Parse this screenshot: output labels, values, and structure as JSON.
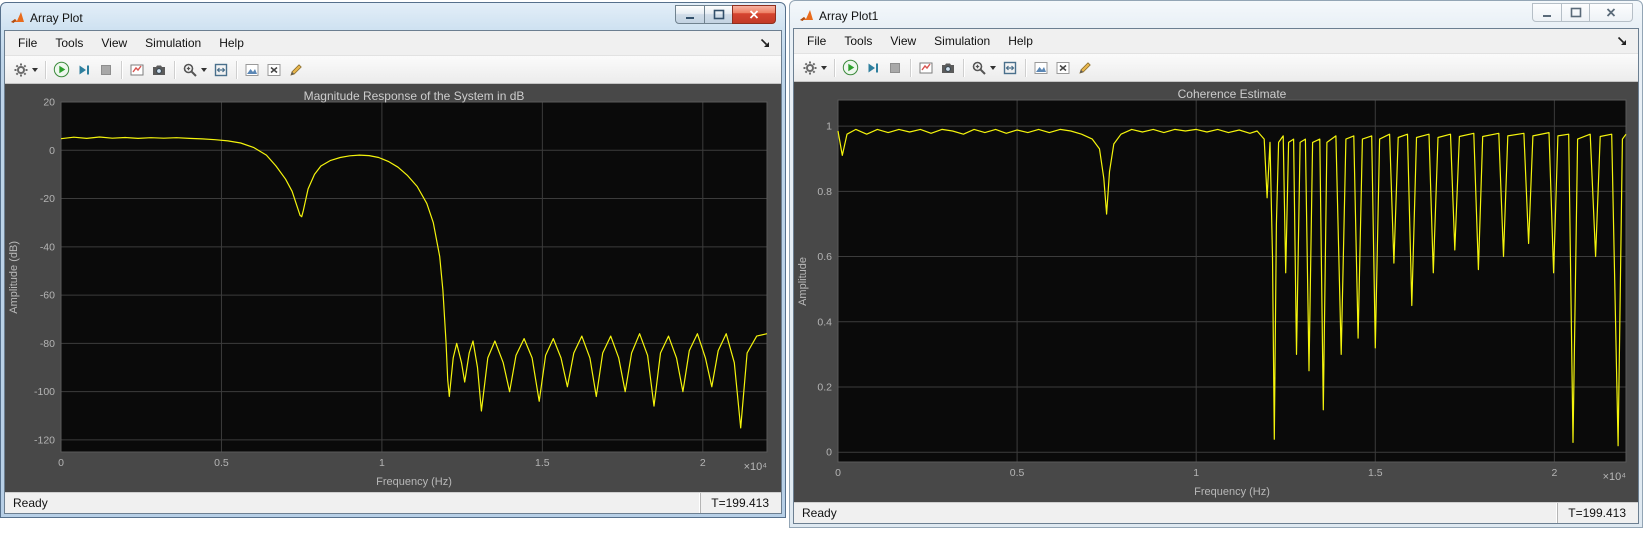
{
  "windows": [
    {
      "title": "Array Plot",
      "menus": [
        "File",
        "Tools",
        "View",
        "Simulation",
        "Help"
      ],
      "status_ready": "Ready",
      "status_time": "T=199.413"
    },
    {
      "title": "Array Plot1",
      "menus": [
        "File",
        "Tools",
        "View",
        "Simulation",
        "Help"
      ],
      "status_ready": "Ready",
      "status_time": "T=199.413"
    }
  ],
  "toolbar_icons": [
    "settings-gear",
    "run",
    "step-forward",
    "stop",
    "simulink-snapshot",
    "camera-snapshot",
    "zoom-in",
    "fit-to-view",
    "scale-y-axis",
    "x-axis-limits",
    "measurements"
  ],
  "colors": {
    "curve": "#f4f40c",
    "plot_bg": "#0a0a0a",
    "grid": "#3c3c3c",
    "axes_border": "#5a5a5a",
    "tick_label": "#b4b4b4",
    "panel_bg": "#484848"
  },
  "chart_data": [
    {
      "type": "line",
      "title": "Magnitude Response of the System in dB",
      "xlabel": "Frequency (Hz)",
      "ylabel": "Amplitude (dB)",
      "x_exponent": "×10⁴",
      "xlim": [
        0,
        2.2
      ],
      "ylim": [
        -125,
        20
      ],
      "xticks": [
        0,
        0.5,
        1,
        1.5,
        2
      ],
      "yticks": [
        20,
        0,
        -20,
        -40,
        -60,
        -80,
        -100,
        -120
      ],
      "grid": true,
      "legend": false,
      "line_color": "#f4f40c",
      "plot_bg": "#0a0a0a",
      "grid_color": "#3c3c3c",
      "border_color": "#5a5a5a",
      "tick_color": "#b4b4b4",
      "points": [
        [
          0,
          4.8
        ],
        [
          0.04,
          5.4
        ],
        [
          0.08,
          4.9
        ],
        [
          0.12,
          5.5
        ],
        [
          0.16,
          5.0
        ],
        [
          0.2,
          5.3
        ],
        [
          0.24,
          4.9
        ],
        [
          0.28,
          5.2
        ],
        [
          0.32,
          5.0
        ],
        [
          0.36,
          5.2
        ],
        [
          0.4,
          4.9
        ],
        [
          0.44,
          4.7
        ],
        [
          0.48,
          4.4
        ],
        [
          0.52,
          3.9
        ],
        [
          0.56,
          3.0
        ],
        [
          0.6,
          1.2
        ],
        [
          0.64,
          -2.0
        ],
        [
          0.67,
          -6.5
        ],
        [
          0.7,
          -12
        ],
        [
          0.72,
          -17
        ],
        [
          0.735,
          -23
        ],
        [
          0.745,
          -27
        ],
        [
          0.75,
          -27.5
        ],
        [
          0.755,
          -25
        ],
        [
          0.77,
          -16
        ],
        [
          0.79,
          -10
        ],
        [
          0.81,
          -6.5
        ],
        [
          0.84,
          -4.2
        ],
        [
          0.87,
          -3.0
        ],
        [
          0.9,
          -2.3
        ],
        [
          0.93,
          -2.0
        ],
        [
          0.96,
          -2.2
        ],
        [
          0.99,
          -3.0
        ],
        [
          1.02,
          -4.6
        ],
        [
          1.05,
          -7
        ],
        [
          1.08,
          -10.5
        ],
        [
          1.11,
          -15
        ],
        [
          1.14,
          -22
        ],
        [
          1.16,
          -30
        ],
        [
          1.18,
          -44
        ],
        [
          1.19,
          -58
        ],
        [
          1.2,
          -80
        ],
        [
          1.205,
          -95
        ],
        [
          1.21,
          -102
        ],
        [
          1.222,
          -86
        ],
        [
          1.233,
          -80
        ],
        [
          1.248,
          -88
        ],
        [
          1.258,
          -96
        ],
        [
          1.272,
          -84
        ],
        [
          1.284,
          -79
        ],
        [
          1.298,
          -90
        ],
        [
          1.31,
          -108
        ],
        [
          1.33,
          -86
        ],
        [
          1.352,
          -79
        ],
        [
          1.378,
          -88
        ],
        [
          1.398,
          -100
        ],
        [
          1.418,
          -85
        ],
        [
          1.443,
          -78
        ],
        [
          1.468,
          -86
        ],
        [
          1.49,
          -104
        ],
        [
          1.51,
          -85
        ],
        [
          1.534,
          -78
        ],
        [
          1.558,
          -86
        ],
        [
          1.578,
          -98
        ],
        [
          1.598,
          -84
        ],
        [
          1.623,
          -77
        ],
        [
          1.648,
          -86
        ],
        [
          1.668,
          -102
        ],
        [
          1.688,
          -84
        ],
        [
          1.713,
          -77
        ],
        [
          1.738,
          -86
        ],
        [
          1.758,
          -100
        ],
        [
          1.778,
          -84
        ],
        [
          1.803,
          -76
        ],
        [
          1.828,
          -85
        ],
        [
          1.848,
          -106
        ],
        [
          1.868,
          -84
        ],
        [
          1.893,
          -77
        ],
        [
          1.918,
          -86
        ],
        [
          1.938,
          -100
        ],
        [
          1.958,
          -83
        ],
        [
          1.983,
          -76
        ],
        [
          2.008,
          -86
        ],
        [
          2.028,
          -98
        ],
        [
          2.048,
          -83
        ],
        [
          2.073,
          -76
        ],
        [
          2.098,
          -88
        ],
        [
          2.118,
          -115
        ],
        [
          2.138,
          -84
        ],
        [
          2.168,
          -77
        ],
        [
          2.2,
          -76
        ]
      ]
    },
    {
      "type": "line",
      "title": "Coherence Estimate",
      "xlabel": "Frequency (Hz)",
      "ylabel": "Amplitude",
      "x_exponent": "×10⁴",
      "xlim": [
        0,
        2.2
      ],
      "ylim": [
        -0.03,
        1.08
      ],
      "xticks": [
        0,
        0.5,
        1,
        1.5,
        2
      ],
      "yticks": [
        0,
        0.2,
        0.4,
        0.6,
        0.8,
        1
      ],
      "grid": true,
      "legend": false,
      "line_color": "#f4f40c",
      "plot_bg": "#0a0a0a",
      "grid_color": "#3c3c3c",
      "border_color": "#5a5a5a",
      "tick_color": "#b4b4b4",
      "points": [
        [
          0,
          0.985
        ],
        [
          0.012,
          0.91
        ],
        [
          0.025,
          0.975
        ],
        [
          0.05,
          0.99
        ],
        [
          0.08,
          0.975
        ],
        [
          0.11,
          0.99
        ],
        [
          0.14,
          0.98
        ],
        [
          0.17,
          0.99
        ],
        [
          0.2,
          0.982
        ],
        [
          0.23,
          0.99
        ],
        [
          0.26,
          0.978
        ],
        [
          0.29,
          0.99
        ],
        [
          0.32,
          0.985
        ],
        [
          0.35,
          0.975
        ],
        [
          0.38,
          0.99
        ],
        [
          0.41,
          0.98
        ],
        [
          0.44,
          0.99
        ],
        [
          0.47,
          0.978
        ],
        [
          0.5,
          0.988
        ],
        [
          0.53,
          0.98
        ],
        [
          0.56,
          0.99
        ],
        [
          0.59,
          0.98
        ],
        [
          0.62,
          0.99
        ],
        [
          0.65,
          0.985
        ],
        [
          0.68,
          0.975
        ],
        [
          0.71,
          0.96
        ],
        [
          0.73,
          0.93
        ],
        [
          0.742,
          0.84
        ],
        [
          0.75,
          0.73
        ],
        [
          0.758,
          0.86
        ],
        [
          0.77,
          0.945
        ],
        [
          0.79,
          0.975
        ],
        [
          0.82,
          0.99
        ],
        [
          0.85,
          0.982
        ],
        [
          0.88,
          0.99
        ],
        [
          0.91,
          0.98
        ],
        [
          0.94,
          0.99
        ],
        [
          0.97,
          0.985
        ],
        [
          1.0,
          0.99
        ],
        [
          1.03,
          0.982
        ],
        [
          1.06,
          0.99
        ],
        [
          1.09,
          0.98
        ],
        [
          1.12,
          0.988
        ],
        [
          1.15,
          0.978
        ],
        [
          1.17,
          0.985
        ],
        [
          1.19,
          0.96
        ],
        [
          1.198,
          0.78
        ],
        [
          1.206,
          0.95
        ],
        [
          1.213,
          0.6
        ],
        [
          1.218,
          0.04
        ],
        [
          1.224,
          0.7
        ],
        [
          1.23,
          0.95
        ],
        [
          1.243,
          0.97
        ],
        [
          1.25,
          0.55
        ],
        [
          1.258,
          0.95
        ],
        [
          1.272,
          0.96
        ],
        [
          1.28,
          0.3
        ],
        [
          1.29,
          0.95
        ],
        [
          1.305,
          0.96
        ],
        [
          1.315,
          0.25
        ],
        [
          1.325,
          0.95
        ],
        [
          1.345,
          0.96
        ],
        [
          1.355,
          0.13
        ],
        [
          1.365,
          0.95
        ],
        [
          1.39,
          0.97
        ],
        [
          1.405,
          0.3
        ],
        [
          1.418,
          0.96
        ],
        [
          1.44,
          0.97
        ],
        [
          1.452,
          0.35
        ],
        [
          1.464,
          0.96
        ],
        [
          1.49,
          0.97
        ],
        [
          1.5,
          0.32
        ],
        [
          1.512,
          0.96
        ],
        [
          1.54,
          0.975
        ],
        [
          1.552,
          0.58
        ],
        [
          1.564,
          0.965
        ],
        [
          1.59,
          0.975
        ],
        [
          1.602,
          0.45
        ],
        [
          1.615,
          0.965
        ],
        [
          1.65,
          0.975
        ],
        [
          1.662,
          0.55
        ],
        [
          1.675,
          0.965
        ],
        [
          1.71,
          0.975
        ],
        [
          1.722,
          0.62
        ],
        [
          1.735,
          0.968
        ],
        [
          1.775,
          0.978
        ],
        [
          1.788,
          0.56
        ],
        [
          1.8,
          0.968
        ],
        [
          1.845,
          0.978
        ],
        [
          1.858,
          0.6
        ],
        [
          1.87,
          0.97
        ],
        [
          1.915,
          0.978
        ],
        [
          1.928,
          0.64
        ],
        [
          1.94,
          0.97
        ],
        [
          1.985,
          0.98
        ],
        [
          1.998,
          0.55
        ],
        [
          2.01,
          0.97
        ],
        [
          2.04,
          0.975
        ],
        [
          2.052,
          0.03
        ],
        [
          2.065,
          0.96
        ],
        [
          2.1,
          0.975
        ],
        [
          2.115,
          0.6
        ],
        [
          2.128,
          0.968
        ],
        [
          2.16,
          0.975
        ],
        [
          2.178,
          0.02
        ],
        [
          2.19,
          0.96
        ],
        [
          2.2,
          0.975
        ]
      ]
    }
  ]
}
